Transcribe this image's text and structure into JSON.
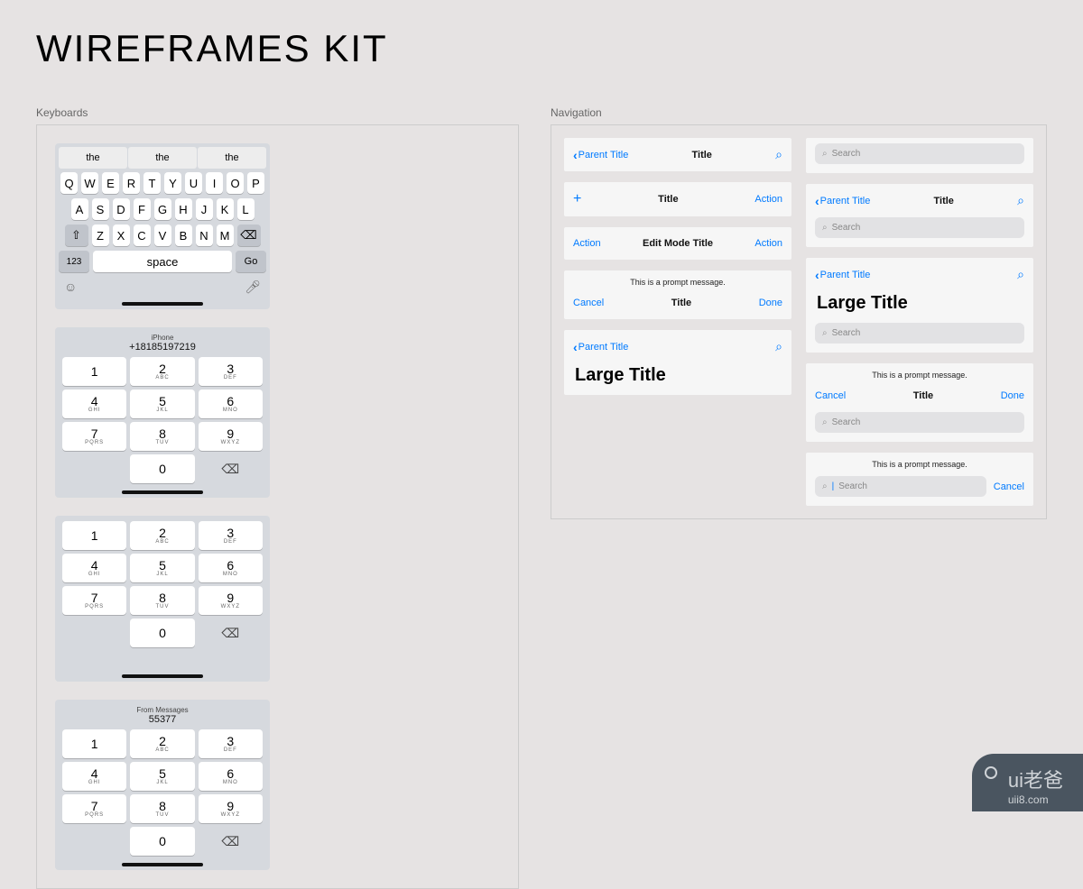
{
  "title": "WIREFRAMES KIT",
  "sections": {
    "keyboards": "Keyboards",
    "navigation": "Navigation"
  },
  "qwerty": {
    "suggestions": [
      "the",
      "the",
      "the"
    ],
    "row1": [
      "Q",
      "W",
      "E",
      "R",
      "T",
      "Y",
      "U",
      "I",
      "O",
      "P"
    ],
    "row2": [
      "A",
      "S",
      "D",
      "F",
      "G",
      "H",
      "J",
      "K",
      "L"
    ],
    "row3": [
      "Z",
      "X",
      "C",
      "V",
      "B",
      "N",
      "M"
    ],
    "fn": "123",
    "space": "space",
    "go": "Go"
  },
  "dial1": {
    "label": "iPhone",
    "number": "+18185197219"
  },
  "dial2": {
    "label": "From Messages",
    "number": "55377"
  },
  "numpad": {
    "keys": [
      {
        "n": "1",
        "l": ""
      },
      {
        "n": "2",
        "l": "ABC"
      },
      {
        "n": "3",
        "l": "DEF"
      },
      {
        "n": "4",
        "l": "GHI"
      },
      {
        "n": "5",
        "l": "JKL"
      },
      {
        "n": "6",
        "l": "MNO"
      },
      {
        "n": "7",
        "l": "PQRS"
      },
      {
        "n": "8",
        "l": "TUV"
      },
      {
        "n": "9",
        "l": "WXYZ"
      }
    ],
    "zero": "0"
  },
  "nav": {
    "parent": "Parent Title",
    "title": "Title",
    "action": "Action",
    "edit": "Edit Mode Title",
    "prompt": "This is a prompt message.",
    "cancel": "Cancel",
    "done": "Done",
    "large": "Large Title",
    "search": "Search"
  },
  "watermark": {
    "cn": "ui老爸",
    "url": "uii8.com"
  }
}
